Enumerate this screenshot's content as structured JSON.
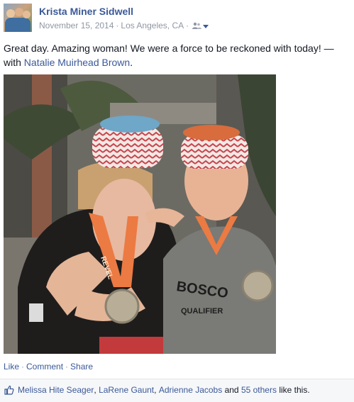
{
  "post": {
    "author": "Krista Miner Sidwell",
    "date": "November 15, 2014",
    "location": "Los Angeles, CA",
    "separator": "·",
    "audience_icon": "friends-icon",
    "status_text": "Great day. Amazing woman! We were a force to be reckoned with today! — with ",
    "tagged_name": "Natalie Muirhead Brown",
    "status_end": "."
  },
  "actions": {
    "like": "Like",
    "comment": "Comment",
    "share": "Share",
    "separator": "·"
  },
  "likes": {
    "names": [
      "Melissa Hite Seager",
      "LaRene Gaunt",
      "Adrienne Jacobs"
    ],
    "comma": ",",
    "and": "and",
    "others": "55 others",
    "suffix": "like this."
  },
  "photo_text": {
    "shirt": "BOSCO",
    "shirt_sub": "QUALIFIER",
    "medal_ribbon": "REVEL"
  },
  "colors": {
    "link": "#3b5998",
    "meta": "#9197a3",
    "text": "#141823"
  }
}
